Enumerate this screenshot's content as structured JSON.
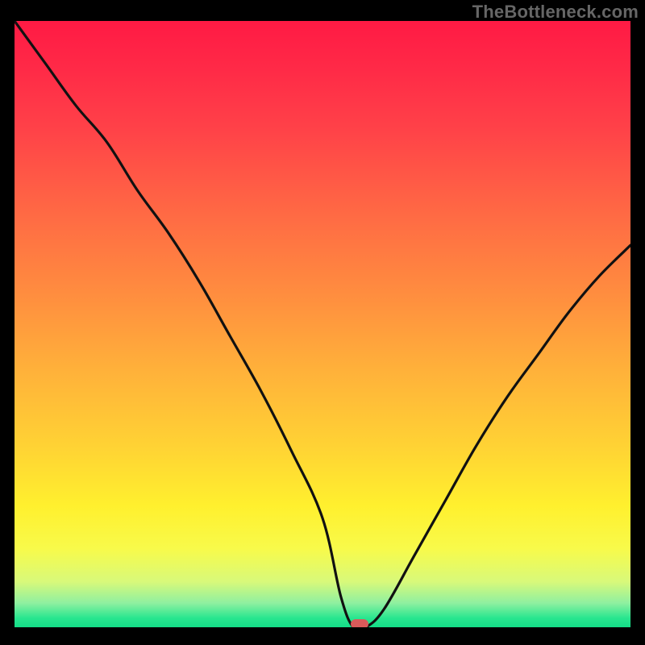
{
  "watermark": "TheBottleneck.com",
  "colors": {
    "frame": "#000000",
    "gradient_stops": [
      "#ff1a44",
      "#ff2a47",
      "#ff4248",
      "#ff6a44",
      "#ff8d3f",
      "#ffb23a",
      "#ffd234",
      "#fff02e",
      "#f8fa4a",
      "#d8f97a",
      "#8ff0a0",
      "#28e68f",
      "#14dd87"
    ],
    "curve": "#111111",
    "marker": "#d95a5a"
  },
  "chart_data": {
    "type": "line",
    "title": "",
    "xlabel": "",
    "ylabel": "",
    "xlim": [
      0,
      100
    ],
    "ylim": [
      0,
      100
    ],
    "x": [
      0,
      5,
      10,
      15,
      20,
      25,
      30,
      35,
      40,
      45,
      50,
      53,
      55,
      57,
      60,
      65,
      70,
      75,
      80,
      85,
      90,
      95,
      100
    ],
    "values": [
      100,
      93,
      86,
      80,
      72,
      65,
      57,
      48,
      39,
      29,
      18,
      5,
      0,
      0,
      3,
      12,
      21,
      30,
      38,
      45,
      52,
      58,
      63
    ],
    "optimum_x": 56,
    "optimum_y": 0,
    "note": "V-shaped bottleneck curve; minimum at ~56% on x-axis; color gradient red→green indicates bottleneck severity top→bottom."
  }
}
